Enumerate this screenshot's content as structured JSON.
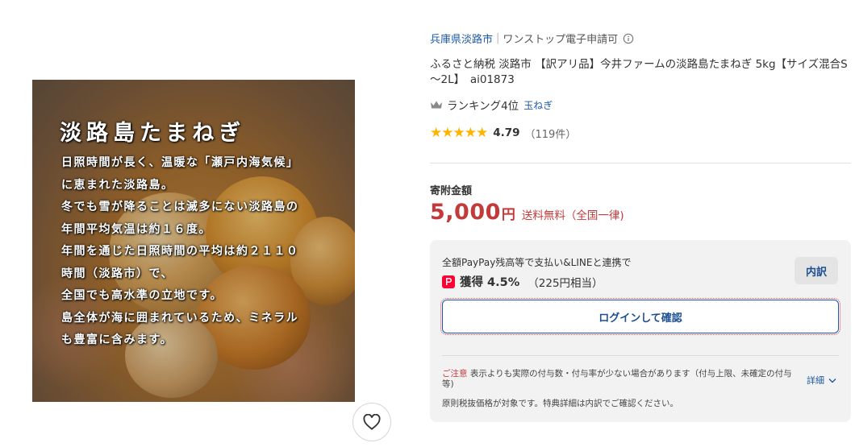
{
  "image": {
    "title": "淡路島たまねぎ",
    "lines": [
      "日照時間が長く、温暖な「瀬戸内海気候」",
      "に恵まれた淡路島。",
      "冬でも雪が降ることは滅多にない淡路島の",
      "年間平均気温は約１６度。",
      "年間を通じた日照時間の平均は約２１１０",
      "時間（淡路市）で、",
      "全国でも高水準の立地です。",
      "島全体が海に囲まれているため、ミネラル",
      "も豊富に含みます。"
    ]
  },
  "store": {
    "name": "兵庫県淡路市",
    "badge": "ワンストップ電子申請可"
  },
  "product": {
    "title": "ふるさと納税 淡路市 【訳アリ品】今井ファームの淡路島たまねぎ 5kg【サイズ混合S～2L】　ai01873"
  },
  "ranking": {
    "text": "ランキング4位",
    "category": "玉ねぎ"
  },
  "rating": {
    "stars": "★★★★★",
    "value": "4.79",
    "count": "（119件）",
    "star_color": "#ffb400"
  },
  "price": {
    "label": "寄附金額",
    "amount": "5,000",
    "unit": "円",
    "shipping": "送料無料（全国一律)",
    "color": "#c33a3a"
  },
  "points": {
    "description": "全額PayPay残高等で支払い&LINEと連携で",
    "get": "獲得 4.5%",
    "yen": "（225円相当）",
    "breakdown_label": "内訳",
    "login_label": "ログインして確認",
    "caution_label": "ご注意",
    "caution_text": "表示よりも実際の付与数・付与率が少ない場合があります（付与上限、未確定の付与等)",
    "details_label": "詳細",
    "note": "原則税抜価格が対象です。特典詳細は内訳でご確認ください。"
  },
  "favorite": {
    "icon": "heart-icon"
  }
}
